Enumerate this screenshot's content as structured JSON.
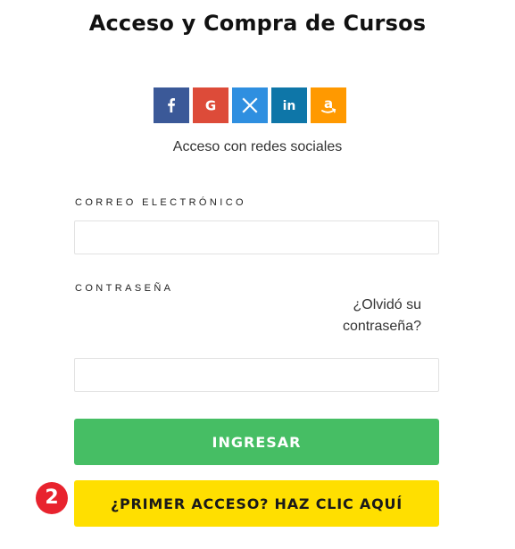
{
  "page": {
    "title": "Acceso y Compra de Cursos"
  },
  "social": {
    "buttons": [
      {
        "name": "facebook",
        "icon": "facebook-icon",
        "color": "#3b5998"
      },
      {
        "name": "google",
        "icon": "google-icon",
        "color": "#dd4b39"
      },
      {
        "name": "x",
        "icon": "x-icon",
        "color": "#2f8fe0"
      },
      {
        "name": "linkedin",
        "icon": "linkedin-icon",
        "color": "#0e76a8"
      },
      {
        "name": "amazon",
        "icon": "amazon-icon",
        "color": "#ff9900"
      }
    ],
    "caption": "Acceso con redes sociales"
  },
  "form": {
    "email_label": "CORREO ELECTRÓNICO",
    "email_value": "",
    "email_placeholder": "",
    "password_label": "CONTRASEÑA",
    "password_value": "",
    "password_placeholder": "",
    "forgot_line1": "¿Olvidó su",
    "forgot_line2": "contraseña?",
    "login_button": "INGRESAR",
    "first_access_button": "¿PRIMER ACCESO? HAZ CLIC AQUÍ"
  },
  "badge": {
    "number": "2",
    "color": "#e8232e"
  }
}
